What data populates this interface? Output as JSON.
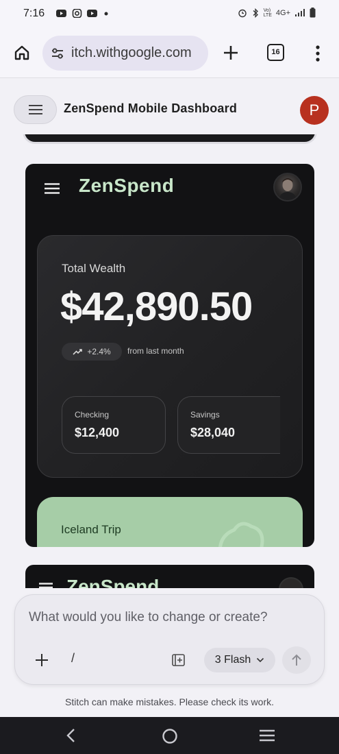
{
  "status_bar": {
    "time": "7:16",
    "network": "4G+",
    "volte_top": "Vo)",
    "volte_bottom": "LTE"
  },
  "browser": {
    "url": "itch.withgoogle.com",
    "tab_count": "16"
  },
  "app_header": {
    "title": "ZenSpend Mobile Dashboard",
    "profile_initial": "P"
  },
  "preview": {
    "brand": "ZenSpend",
    "wealth": {
      "label": "Total Wealth",
      "amount": "$42,890.50",
      "change": "+2.4%",
      "change_note": "from last month"
    },
    "accounts": [
      {
        "name": "Checking",
        "value": "$12,400"
      },
      {
        "name": "Savings",
        "value": "$28,040"
      }
    ],
    "goal": {
      "title": "Iceland Trip"
    },
    "next_brand": "ZenSpend"
  },
  "prompt": {
    "placeholder": "What would you like to change or create?",
    "slash": "/",
    "model": "3 Flash"
  },
  "disclaimer": "Stitch can make mistakes. Please check its work.",
  "colors": {
    "brand_green": "#c8e6c9",
    "goal_card": "#a6cda7",
    "avatar_red": "#b8311f"
  }
}
